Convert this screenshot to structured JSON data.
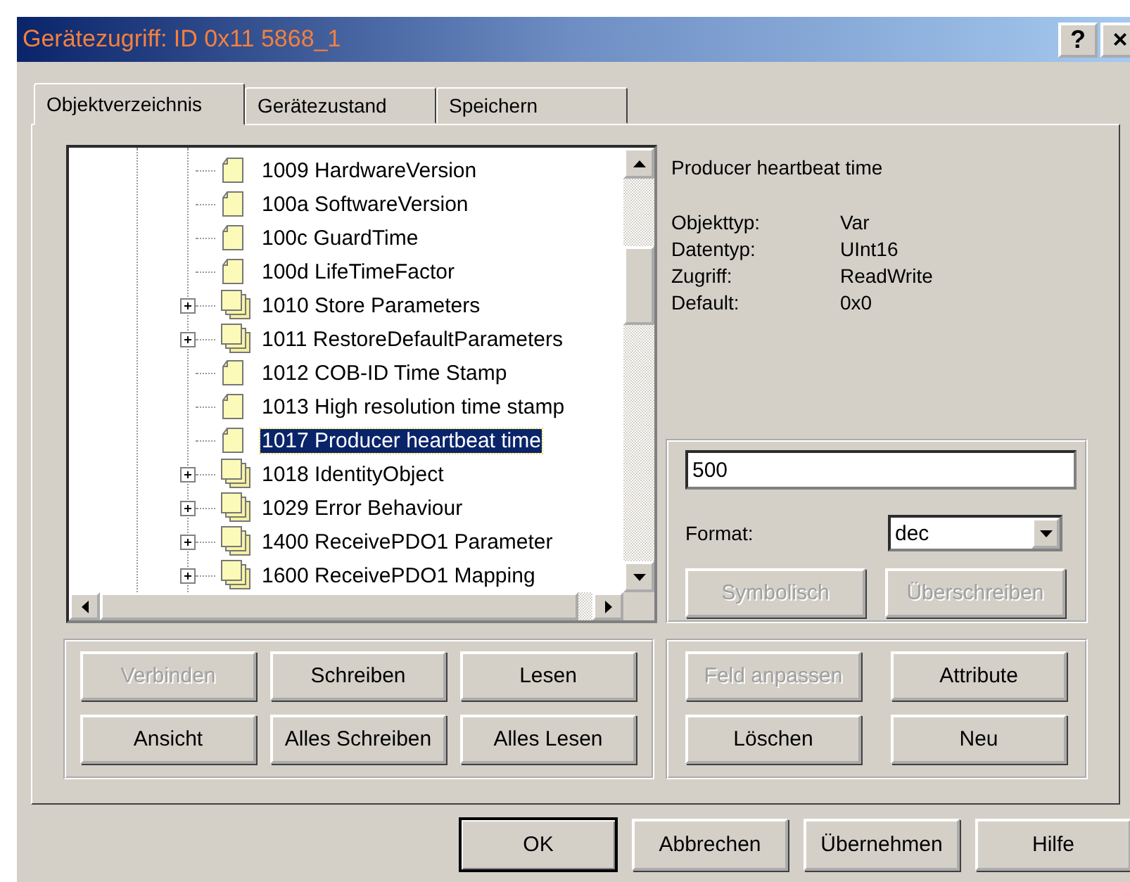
{
  "window": {
    "title": "Gerätezugriff: ID 0x11 5868_1",
    "title_buttons": [
      "?",
      "×"
    ]
  },
  "tabs": [
    {
      "label": "Objektverzeichnis",
      "selected": true
    },
    {
      "label": "Gerätezustand",
      "selected": false
    },
    {
      "label": "Speichern",
      "selected": false
    }
  ],
  "tree": {
    "items": [
      {
        "label": "1009 HardwareVersion",
        "kind": "object",
        "selected": false
      },
      {
        "label": "100a SoftwareVersion",
        "kind": "object",
        "selected": false
      },
      {
        "label": "100c GuardTime",
        "kind": "object",
        "selected": false
      },
      {
        "label": "100d LifeTimeFactor",
        "kind": "object",
        "selected": false
      },
      {
        "label": "1010 Store Parameters",
        "kind": "group",
        "selected": false
      },
      {
        "label": "1011 RestoreDefaultParameters",
        "kind": "group",
        "selected": false
      },
      {
        "label": "1012 COB-ID Time Stamp",
        "kind": "object",
        "selected": false
      },
      {
        "label": "1013 High resolution time stamp",
        "kind": "object",
        "selected": false
      },
      {
        "label": "1017 Producer heartbeat time",
        "kind": "object",
        "selected": true
      },
      {
        "label": "1018 IdentityObject",
        "kind": "group",
        "selected": false
      },
      {
        "label": "1029 Error Behaviour",
        "kind": "group",
        "selected": false
      },
      {
        "label": "1400 ReceivePDO1 Parameter",
        "kind": "group",
        "selected": false
      },
      {
        "label": "1600 ReceivePDO1 Mapping",
        "kind": "group",
        "selected": false
      }
    ]
  },
  "details": {
    "title": "Producer heartbeat time",
    "properties": [
      {
        "label": "Objekttyp:",
        "value": "Var"
      },
      {
        "label": "Datentyp:",
        "value": "UInt16"
      },
      {
        "label": "Zugriff:",
        "value": "ReadWrite"
      },
      {
        "label": "Default:",
        "value": "0x0"
      }
    ]
  },
  "value_editor": {
    "value": "500",
    "format_label": "Format:",
    "format": "dec",
    "buttons": [
      {
        "label": "Symbolisch",
        "disabled": true
      },
      {
        "label": "Überschreiben",
        "disabled": true
      }
    ]
  },
  "actions_left": [
    {
      "label": "Verbinden",
      "disabled": true
    },
    {
      "label": "Schreiben",
      "disabled": false
    },
    {
      "label": "Lesen",
      "disabled": false
    },
    {
      "label": "Ansicht",
      "disabled": false
    },
    {
      "label": "Alles Schreiben",
      "disabled": false
    },
    {
      "label": "Alles Lesen",
      "disabled": false
    }
  ],
  "actions_right": [
    {
      "label": "Feld anpassen",
      "disabled": true
    },
    {
      "label": "Attribute",
      "disabled": false
    },
    {
      "label": "Löschen",
      "disabled": false
    },
    {
      "label": "Neu",
      "disabled": false
    }
  ],
  "dialog_buttons": [
    {
      "label": "OK",
      "default": true
    },
    {
      "label": "Abbrechen",
      "default": false
    },
    {
      "label": "Übernehmen",
      "default": false
    },
    {
      "label": "Hilfe",
      "default": false
    }
  ]
}
